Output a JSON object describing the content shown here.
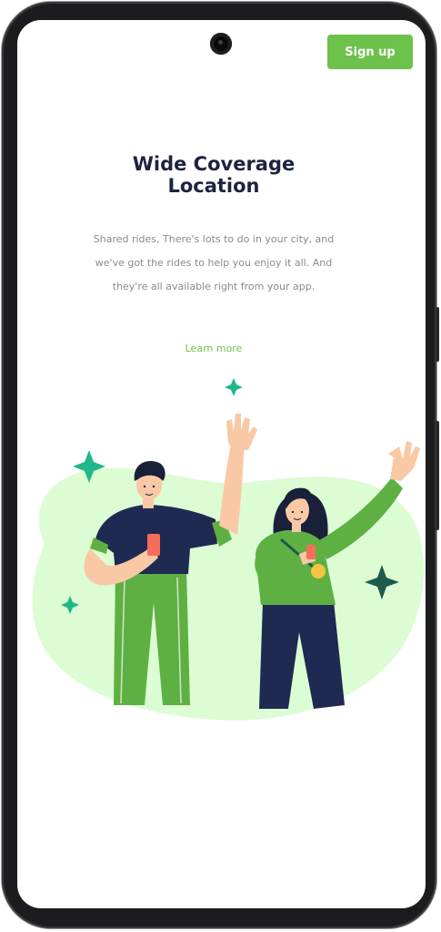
{
  "header": {
    "signup_label": "Sign up"
  },
  "onboarding": {
    "title_line1": "Wide Coverage",
    "title_line2": "Location",
    "description_line1": "Shared rides, There's lots to do in your city, and",
    "description_line2": "we've got the rides to help you enjoy it all. And",
    "description_line3": "they're all available right from your app.",
    "learn_more_label": "Learn more"
  },
  "colors": {
    "accent": "#6cc24a",
    "title": "#1e2340",
    "body_text": "#8a8a8a",
    "blob": "#dcfcd4",
    "sparkle": "#1fb88a",
    "navy": "#1f2a52"
  },
  "icons": [
    "front-camera",
    "sparkle-icon"
  ]
}
